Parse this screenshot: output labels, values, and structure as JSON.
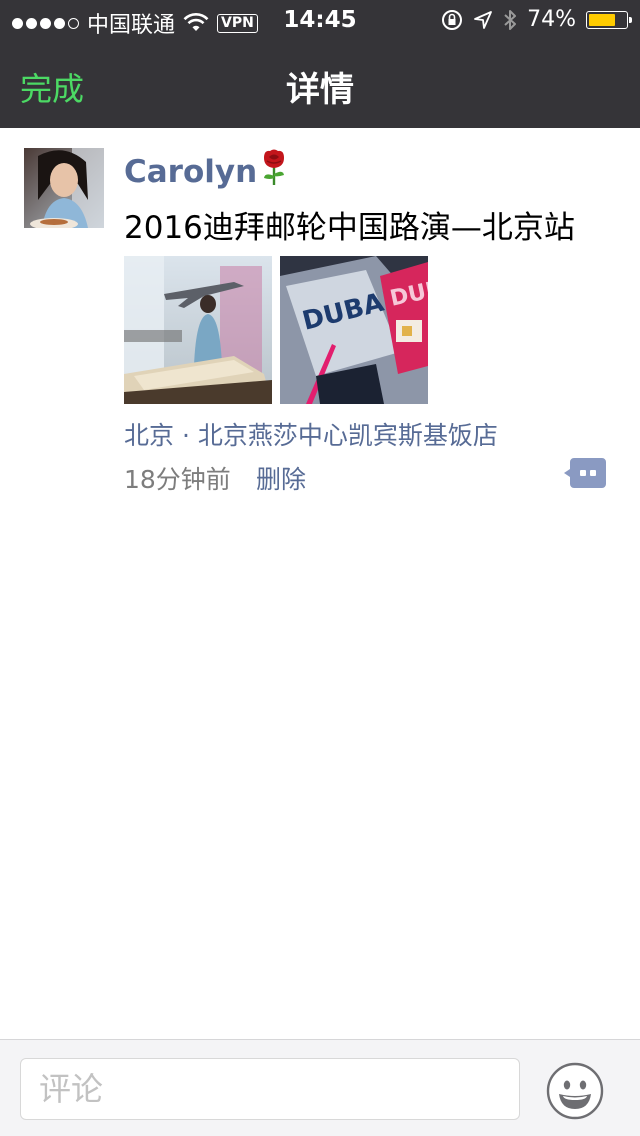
{
  "status_bar": {
    "carrier": "中国联通",
    "vpn": "VPN",
    "time": "14:45",
    "battery": "74%",
    "battery_level": 0.74,
    "battery_color": "#ffcc00"
  },
  "nav": {
    "done_label": "完成",
    "title": "详情",
    "done_color": "#4cd964"
  },
  "post": {
    "author": "Carolyn",
    "text": "2016迪拜邮轮中国路演—北京站",
    "location": "北京 · 北京燕莎中心凯宾斯基饭店",
    "time_ago": "18分钟前",
    "delete_label": "删除",
    "link_color": "#576b95"
  },
  "comment_bar": {
    "placeholder": "评论"
  }
}
